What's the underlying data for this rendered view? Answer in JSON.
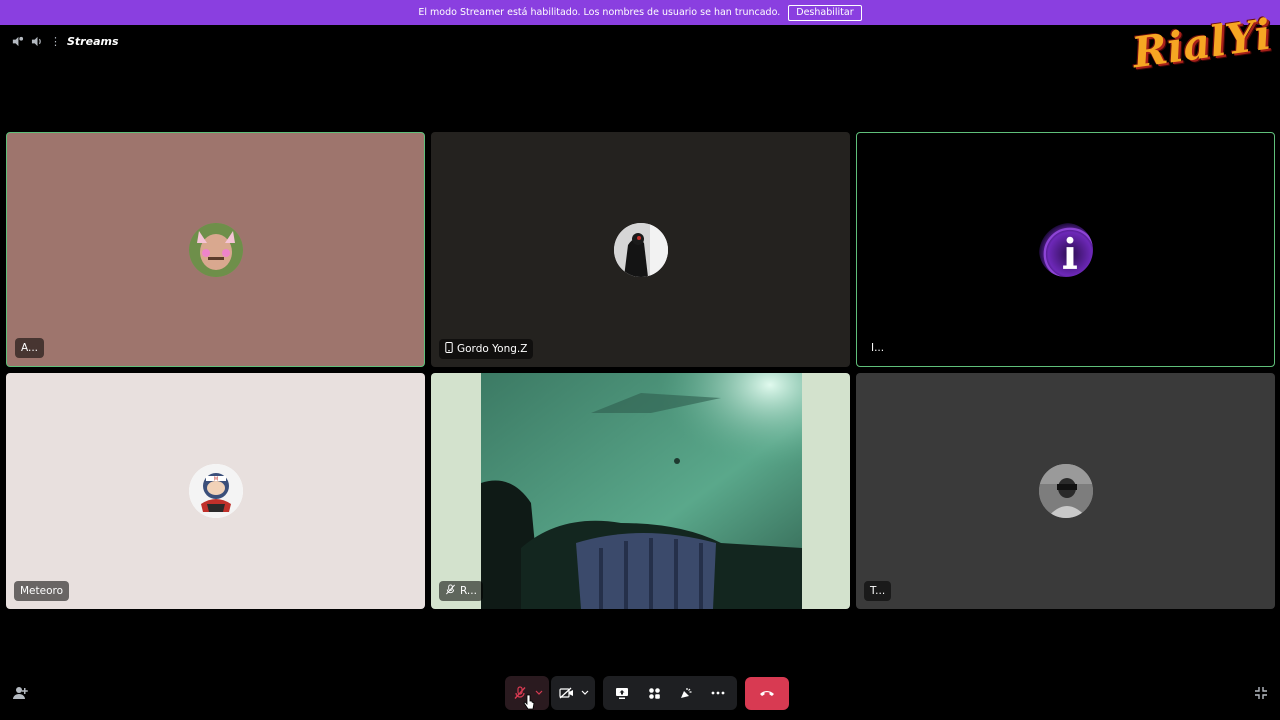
{
  "banner": {
    "message": "El modo Streamer está habilitado. Los nombres de usuario se han truncado.",
    "button_label": "Deshabilitar"
  },
  "header": {
    "channel_name": "Streams",
    "channel_prefix": "⋮"
  },
  "logo": {
    "text": "RialYi"
  },
  "participants": [
    {
      "name": "A...",
      "speaking": true,
      "background": "#9e756d",
      "device_icon": ""
    },
    {
      "name": "Gordo Yong.Z",
      "speaking": false,
      "background": "#24221f",
      "device_icon": "phone-icon"
    },
    {
      "name": "I...",
      "speaking": true,
      "background": "#000000",
      "device_icon": ""
    },
    {
      "name": "Meteoro",
      "speaking": false,
      "background": "#e8e0de",
      "device_icon": ""
    },
    {
      "name": "R...",
      "speaking": false,
      "background": "#d3e2cd",
      "device_icon": "muted-mic-icon",
      "video": true
    },
    {
      "name": "T...",
      "speaking": false,
      "background": "#3a3a3a",
      "device_icon": ""
    }
  ],
  "controls": {
    "mic": "muted-mic-icon",
    "camera": "camera-off-icon",
    "screen_share": "screen-share-icon",
    "activities": "activities-icon",
    "soundboard": "soundboard-icon",
    "more": "more-icon",
    "end_call": "end-call-icon"
  },
  "colors": {
    "banner": "#8a3fe0",
    "speaking_border": "#5fbf7a",
    "end_call": "#d83a52"
  }
}
